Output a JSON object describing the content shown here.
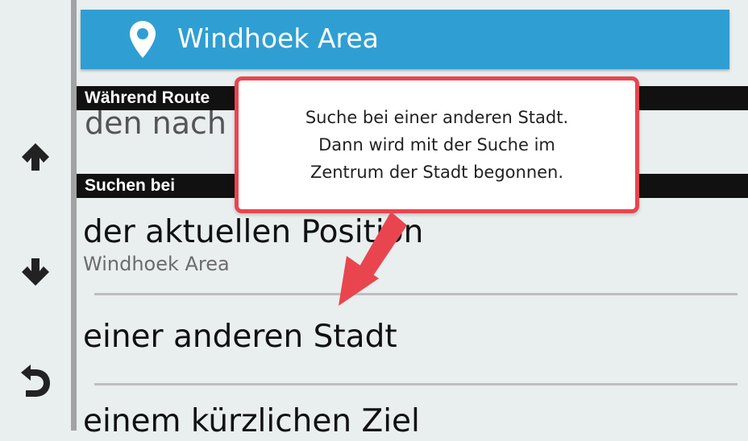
{
  "location_bar": {
    "label": "Windhoek Area",
    "icon": "map-pin-icon"
  },
  "sections": [
    {
      "header": "Während Route",
      "item": "den nach"
    },
    {
      "header": "Suchen bei"
    }
  ],
  "options": [
    {
      "title": "der aktuellen Position",
      "subtitle": "Windhoek Area"
    },
    {
      "title": "einer anderen Stadt"
    },
    {
      "title": "einem kürzlichen Ziel"
    }
  ],
  "nav": {
    "up_icon": "arrow-up-icon",
    "down_icon": "arrow-down-icon",
    "back_icon": "back-icon"
  },
  "callout": {
    "lines": [
      "Suche bei einer anderen Stadt.",
      "Dann wird mit der Suche im",
      "Zentrum der Stadt begonnen."
    ]
  },
  "colors": {
    "accent": "#2f9fd3",
    "callout_border": "#e9454f",
    "header_bg": "#111111"
  }
}
